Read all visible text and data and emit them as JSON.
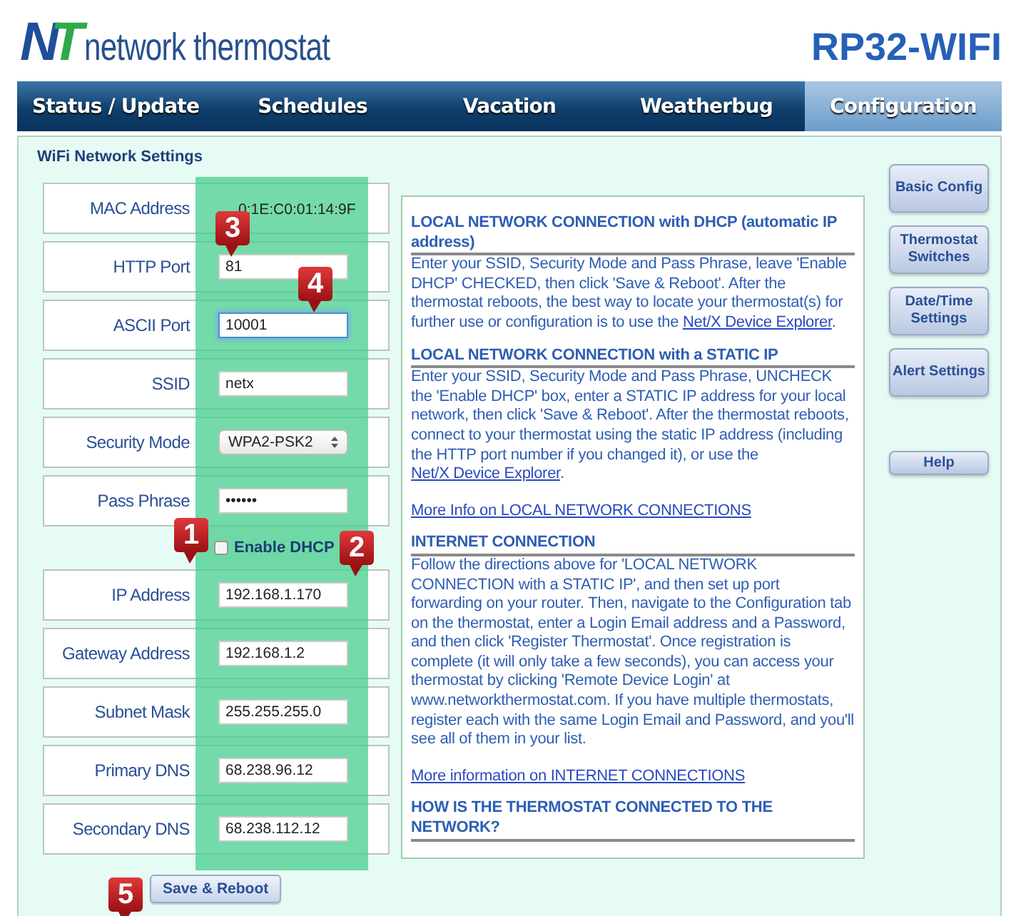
{
  "header": {
    "logo": {
      "letters": [
        {
          "text": "N",
          "color": "#1f4e9a"
        },
        {
          "text": "T",
          "color": "#2eaa4a"
        }
      ],
      "name": "network thermostat"
    },
    "model": "RP32-WIFI"
  },
  "tabs": [
    {
      "label": "Status / Update",
      "selected": false
    },
    {
      "label": "Schedules",
      "selected": false
    },
    {
      "label": "Vacation",
      "selected": false
    },
    {
      "label": "Weatherbug",
      "selected": false
    },
    {
      "label": "Configuration",
      "selected": true
    }
  ],
  "form": {
    "title": "WiFi Network Settings",
    "fields": [
      {
        "kind": "static",
        "label": "MAC Address",
        "value": "0:1E:C0:01:14:9F"
      },
      {
        "kind": "text",
        "label": "HTTP Port",
        "value": "81",
        "focused": false,
        "callout": "3"
      },
      {
        "kind": "text",
        "label": "ASCII Port",
        "value": "10001",
        "focused": true,
        "callout": "4"
      },
      {
        "kind": "text",
        "label": "SSID",
        "value": "netx",
        "focused": false
      },
      {
        "kind": "select",
        "label": "Security Mode",
        "value": "WPA2-PSK2"
      },
      {
        "kind": "text",
        "label": "Pass Phrase",
        "value": "••••••",
        "focused": false
      },
      {
        "kind": "checkbox",
        "label": "Enable DHCP",
        "checked": false,
        "callout": "1"
      },
      {
        "kind": "text",
        "label": "IP Address",
        "value": "192.168.1.170",
        "focused": false,
        "callout": "2"
      },
      {
        "kind": "text",
        "label": "Gateway Address",
        "value": "192.168.1.2",
        "focused": false
      },
      {
        "kind": "text",
        "label": "Subnet Mask",
        "value": "255.255.255.0",
        "focused": false
      },
      {
        "kind": "text",
        "label": "Primary DNS",
        "value": "68.238.96.12",
        "focused": false
      },
      {
        "kind": "text",
        "label": "Secondary DNS",
        "value": "68.238.112.12",
        "focused": false
      }
    ],
    "submit": {
      "label": "Save & Reboot",
      "callout": "5"
    }
  },
  "info": [
    {
      "kind": "heading",
      "text": "LOCAL NETWORK CONNECTION with DHCP (automatic IP address)"
    },
    {
      "kind": "paragraph",
      "parts": [
        {
          "kind": "text",
          "text": "Enter your SSID, Security Mode and Pass Phrase, leave 'Enable DHCP' CHECKED, then click 'Save & Reboot'. After the thermostat reboots, the best way to locate your thermostat(s) for further use or configuration is to use the "
        },
        {
          "kind": "link",
          "text": "Net/X Device Explorer"
        },
        {
          "kind": "text",
          "text": "."
        }
      ]
    },
    {
      "kind": "heading",
      "text": "LOCAL NETWORK CONNECTION with a STATIC IP"
    },
    {
      "kind": "paragraph",
      "parts": [
        {
          "kind": "text",
          "text": "Enter your SSID, Security Mode and Pass Phrase, UNCHECK the 'Enable DHCP' box, enter a STATIC IP address for your local network, then click 'Save & Reboot'. After the thermostat reboots, connect to your thermostat using the static IP address (including the HTTP port number if you changed it), or use the "
        },
        {
          "kind": "link",
          "text": "Net/X Device Explorer"
        },
        {
          "kind": "text",
          "text": "."
        }
      ]
    },
    {
      "kind": "link",
      "text": "More Info on LOCAL NETWORK CONNECTIONS"
    },
    {
      "kind": "heading",
      "text": "INTERNET CONNECTION"
    },
    {
      "kind": "paragraph",
      "parts": [
        {
          "kind": "text",
          "text": "Follow the directions above for 'LOCAL NETWORK CONNECTION with a STATIC IP', and then set up port forwarding on your router. Then, navigate to the Configuration tab on the thermostat, enter a Login Email address and a Password, and then click 'Register Thermostat'. Once registration is complete (it will only take a few seconds), you can access your thermostat by clicking 'Remote Device Login' at www.networkthermostat.com. If you have multiple thermostats, register each with the same Login Email and Password, and you'll see all of them in your list."
        }
      ]
    },
    {
      "kind": "link",
      "text": "More information on INTERNET CONNECTIONS"
    },
    {
      "kind": "heading",
      "text": "HOW IS THE THERMOSTAT CONNECTED TO THE NETWORK?"
    }
  ],
  "side_buttons": [
    {
      "label": "Basic Config",
      "kind": "menu"
    },
    {
      "label": "Thermostat Switches",
      "kind": "menu"
    },
    {
      "label": "Date/Time Settings",
      "kind": "menu"
    },
    {
      "label": "Alert Settings",
      "kind": "menu"
    },
    {
      "label": "Help",
      "kind": "help"
    }
  ]
}
